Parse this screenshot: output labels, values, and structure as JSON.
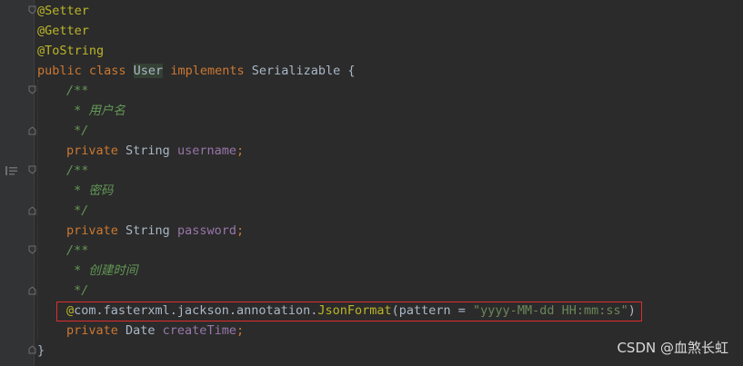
{
  "editor": {
    "lines": [
      {
        "indent": 0,
        "tokens": [
          {
            "t": "@Setter",
            "c": "ann"
          }
        ]
      },
      {
        "indent": 0,
        "tokens": [
          {
            "t": "@Getter",
            "c": "ann"
          }
        ]
      },
      {
        "indent": 0,
        "tokens": [
          {
            "t": "@ToString",
            "c": "ann"
          }
        ]
      },
      {
        "indent": 0,
        "tokens": [
          {
            "t": "public class ",
            "c": "kw"
          },
          {
            "t": "User",
            "c": "cls-hl"
          },
          {
            "t": " implements ",
            "c": "kw"
          },
          {
            "t": "Serializable {",
            "c": "plain"
          }
        ]
      },
      {
        "indent": 1,
        "tokens": [
          {
            "t": "/**",
            "c": "doc"
          }
        ]
      },
      {
        "indent": 1,
        "tokens": [
          {
            "t": " * 用户名",
            "c": "doc"
          }
        ]
      },
      {
        "indent": 1,
        "tokens": [
          {
            "t": " */",
            "c": "doc"
          }
        ]
      },
      {
        "indent": 1,
        "tokens": [
          {
            "t": "private ",
            "c": "kw"
          },
          {
            "t": "String ",
            "c": "plain"
          },
          {
            "t": "username",
            "c": "field"
          },
          {
            "t": ";",
            "c": "kw"
          }
        ]
      },
      {
        "indent": 1,
        "tokens": [
          {
            "t": "/**",
            "c": "doc"
          }
        ]
      },
      {
        "indent": 1,
        "tokens": [
          {
            "t": " * 密码",
            "c": "doc"
          }
        ]
      },
      {
        "indent": 1,
        "tokens": [
          {
            "t": " */",
            "c": "doc"
          }
        ]
      },
      {
        "indent": 1,
        "tokens": [
          {
            "t": "private ",
            "c": "kw"
          },
          {
            "t": "String ",
            "c": "plain"
          },
          {
            "t": "password",
            "c": "field"
          },
          {
            "t": ";",
            "c": "kw"
          }
        ]
      },
      {
        "indent": 1,
        "tokens": [
          {
            "t": "/**",
            "c": "doc"
          }
        ]
      },
      {
        "indent": 1,
        "tokens": [
          {
            "t": " * 创建时间",
            "c": "doc"
          }
        ]
      },
      {
        "indent": 1,
        "tokens": [
          {
            "t": " */",
            "c": "doc"
          }
        ]
      },
      {
        "indent": 1,
        "tokens": [
          {
            "t": "@com.fasterxml.jackson.annotation.",
            "c": "plain",
            "lead": "ann"
          },
          {
            "t": "JsonFormat",
            "c": "ann"
          },
          {
            "t": "(pattern = ",
            "c": "plain"
          },
          {
            "t": "\"yyyy-MM-dd HH:mm:ss\"",
            "c": "str"
          },
          {
            "t": ")",
            "c": "plain"
          }
        ]
      },
      {
        "indent": 1,
        "tokens": [
          {
            "t": "private ",
            "c": "kw"
          },
          {
            "t": "Date ",
            "c": "plain"
          },
          {
            "t": "createTime",
            "c": "field"
          },
          {
            "t": ";",
            "c": "kw"
          }
        ]
      },
      {
        "indent": 0,
        "tokens": [
          {
            "t": "}",
            "c": "plain"
          }
        ]
      }
    ]
  },
  "watermark": "CSDN @血煞长虹",
  "colors": {
    "background": "#2b2b2b",
    "keyword": "#cc7832",
    "annotation": "#bbb529",
    "doc_comment": "#629755",
    "field": "#9876aa",
    "string": "#6a8759",
    "highlight_box": "#e02c2c"
  }
}
